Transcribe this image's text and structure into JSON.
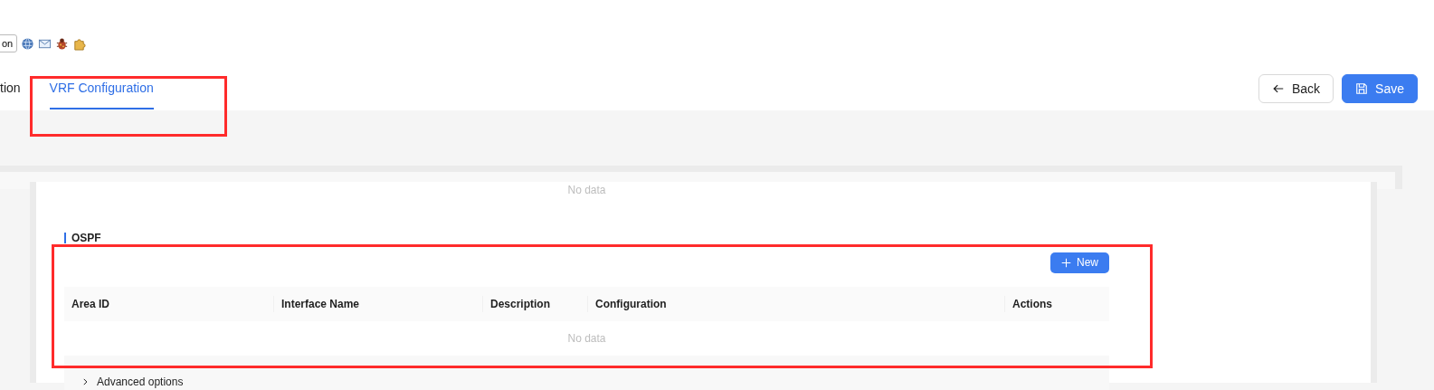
{
  "toolbar": {
    "button_label": "on"
  },
  "tabs": [
    {
      "label": "tion",
      "selected": false
    },
    {
      "label": "VRF Configuration",
      "selected": true
    }
  ],
  "actions": [
    {
      "kind": "back",
      "label": "Back"
    },
    {
      "kind": "save",
      "label": "Save"
    }
  ],
  "top_empty_text": "No data",
  "ospf": {
    "title": "OSPF",
    "new_button": "New",
    "table": {
      "columns": [
        "Area ID",
        "Interface Name",
        "Description",
        "Configuration",
        "Actions"
      ],
      "empty_text": "No data"
    },
    "advanced": {
      "label": "Advanced options",
      "expanded": false
    }
  }
}
